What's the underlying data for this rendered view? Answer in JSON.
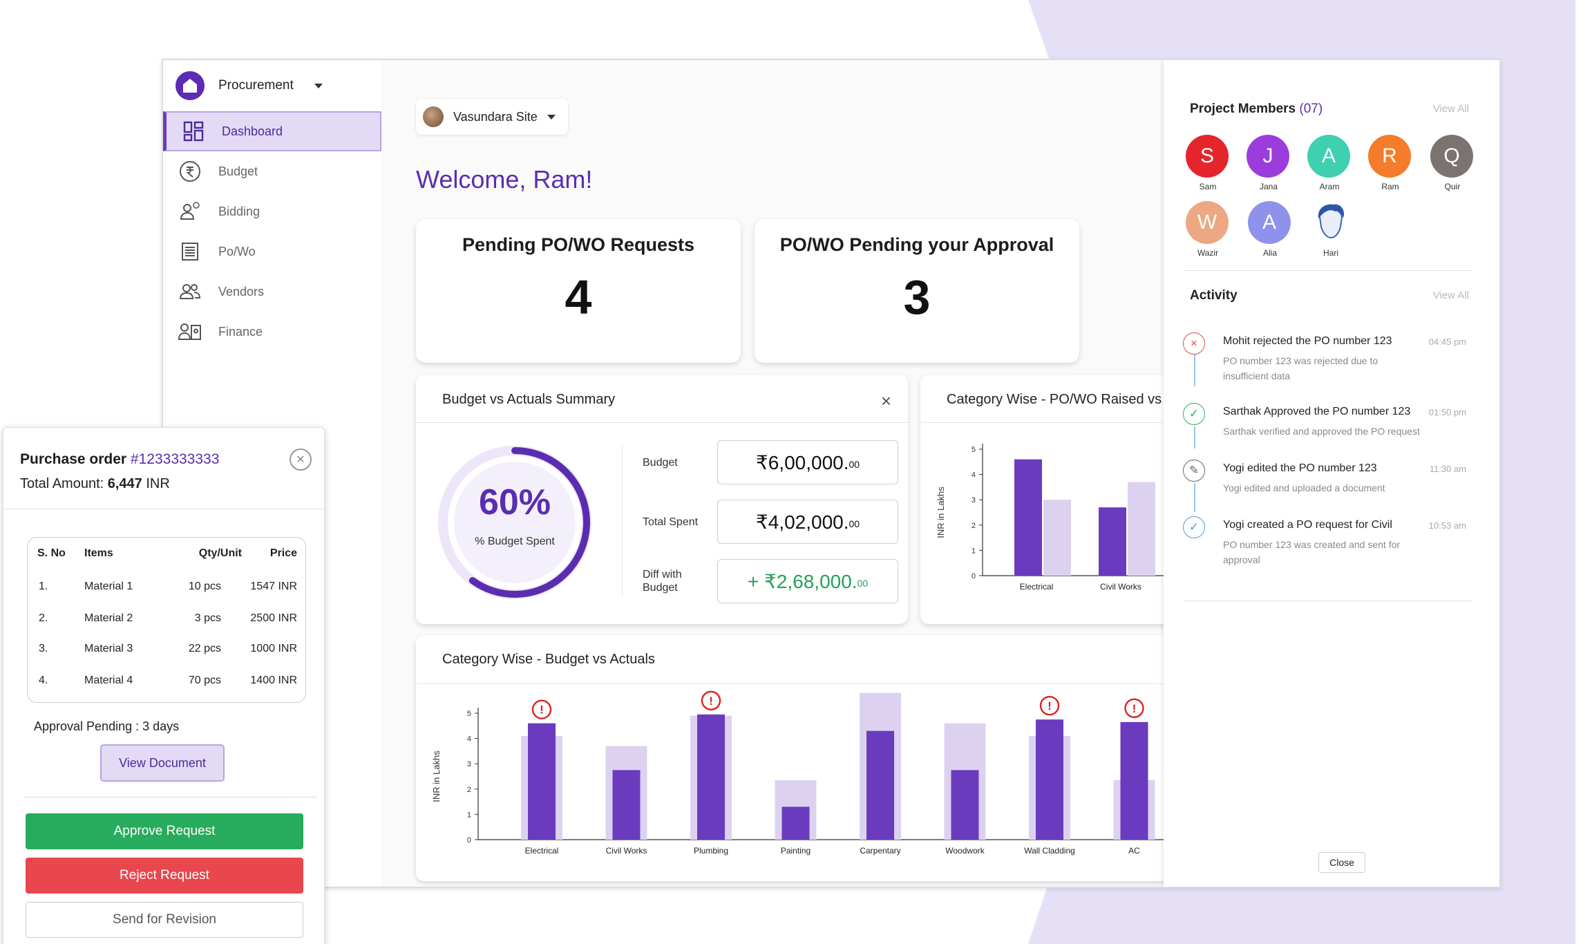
{
  "sidebar": {
    "brand": "Procurement",
    "items": [
      {
        "label": "Dashboard",
        "icon": "dashboard-grid-icon",
        "active": true
      },
      {
        "label": "Budget",
        "icon": "rupee-circle-icon"
      },
      {
        "label": "Bidding",
        "icon": "user-bid-icon"
      },
      {
        "label": "Po/Wo",
        "icon": "document-list-icon"
      },
      {
        "label": "Vendors",
        "icon": "users-icon"
      },
      {
        "label": "Finance",
        "icon": "id-card-icon"
      }
    ]
  },
  "header": {
    "site": "Vasundara Site",
    "welcome": "Welcome, Ram!"
  },
  "stats": {
    "pending_title": "Pending PO/WO Requests",
    "pending_value": "4",
    "approval_title": "PO/WO Pending your Approval",
    "approval_value": "3"
  },
  "budget_summary": {
    "title": "Budget vs Actuals Summary",
    "close": "×",
    "percent": "60%",
    "percent_label": "% Budget Spent",
    "budget_label": "Budget",
    "budget_main": "₹6,00,000.",
    "budget_decimal": "00",
    "spent_label": "Total Spent",
    "spent_main": "₹4,02,000.",
    "spent_decimal": "00",
    "diff_label": "Diff with Budget",
    "diff_main": "+ ₹2,68,000.",
    "diff_decimal": "00"
  },
  "category_raised": {
    "title": "Category Wise - PO/WO Raised vs F"
  },
  "category_budget": {
    "title": "Category Wise - Budget vs Actuals"
  },
  "chart_data": [
    {
      "type": "bar",
      "title": "Category Wise - PO/WO Raised vs F",
      "ylabel": "INR in Lakhs",
      "ylim": [
        0,
        5
      ],
      "yticks": [
        "0",
        "1",
        "2",
        "3",
        "4",
        "5"
      ],
      "categories": [
        "Electrical",
        "Civil Works"
      ],
      "series": [
        {
          "values": [
            4.6,
            2.7
          ],
          "color": "#6a3bbf"
        },
        {
          "values": [
            3.0,
            3.7
          ],
          "color": "#dcd2f0"
        }
      ]
    },
    {
      "type": "bar",
      "title": "Category Wise - Budget vs Actuals",
      "ylabel": "INR in Lakhs",
      "ylim": [
        0,
        5
      ],
      "yticks": [
        "0",
        "1",
        "2",
        "3",
        "4",
        "5"
      ],
      "categories": [
        "Electrical",
        "Civil Works",
        "Plumbing",
        "Painting",
        "Carpentary",
        "Woodwork",
        "Wall Cladding",
        "AC"
      ],
      "series": [
        {
          "values": [
            4.1,
            3.7,
            4.9,
            2.35,
            5.8,
            4.6,
            4.1,
            2.35
          ],
          "color": "#dcd2f0"
        },
        {
          "values": [
            4.6,
            2.75,
            4.95,
            1.3,
            4.3,
            2.75,
            4.75,
            4.65
          ],
          "color": "#6a3bbf"
        }
      ],
      "alerts": [
        true,
        false,
        true,
        false,
        false,
        false,
        true,
        true
      ]
    }
  ],
  "members": {
    "title": "Project Members",
    "count": "(07)",
    "view_all": "View All",
    "list": [
      {
        "initial": "S",
        "name": "Sam",
        "color": "#e4262c"
      },
      {
        "initial": "J",
        "name": "Jana",
        "color": "#9b3ddd"
      },
      {
        "initial": "A",
        "name": "Aram",
        "color": "#3fd0b0"
      },
      {
        "initial": "R",
        "name": "Ram",
        "color": "#f57c2a"
      },
      {
        "initial": "Q",
        "name": "Quir",
        "color": "#7b7370"
      },
      {
        "initial": "W",
        "name": "Wazir",
        "color": "#eba882"
      },
      {
        "initial": "A",
        "name": "Alia",
        "color": "#8f92ec"
      },
      {
        "initial": "",
        "name": "Hari",
        "color": "#6f8fc8"
      }
    ]
  },
  "activity": {
    "title": "Activity",
    "view_all": "View All",
    "items": [
      {
        "icon": "×",
        "color": "#e4484e",
        "title": "Mohit rejected the PO number 123",
        "desc": "PO number 123 was rejected due to insufficient data",
        "time": "04:45 pm"
      },
      {
        "icon": "✓",
        "color": "#2fae66",
        "title": "Sarthak Approved the PO number 123",
        "desc": "Sarthak verified and approved the PO request",
        "time": "01:50 pm"
      },
      {
        "icon": "✎",
        "color": "#666666",
        "title": "Yogi edited the PO number 123",
        "desc": "Yogi edited and uploaded a document",
        "time": "11:30 am"
      },
      {
        "icon": "✓",
        "color": "#4a9be0",
        "title": "Yogi created a PO request for Civil",
        "desc": "PO number 123 was created and sent for approval",
        "time": "10:53 am"
      }
    ],
    "close": "Close"
  },
  "purchase_order": {
    "title": "Purchase order",
    "number": "#1233333333",
    "total_label": "Total Amount:",
    "total_value": "6,447",
    "currency": "INR",
    "headers": [
      "S. No",
      "Items",
      "Qty/Unit",
      "Price"
    ],
    "rows": [
      [
        "1.",
        "Material 1",
        "10 pcs",
        "1547 INR"
      ],
      [
        "2.",
        "Material 2",
        "3 pcs",
        "2500 INR"
      ],
      [
        "3.",
        "Material 3",
        "22 pcs",
        "1000 INR"
      ],
      [
        "4.",
        "Material 4",
        "70 pcs",
        "1400 INR"
      ]
    ],
    "approval_label": "Approval Pending",
    "approval_value": ": 3 days",
    "view_document": "View Document",
    "approve": "Approve Request",
    "reject": "Reject Request",
    "revise": "Send for Revision"
  },
  "colors": {
    "accent": "#5a2db0",
    "bar_dark": "#6a3bbf",
    "bar_light": "#dcd2f0",
    "alert": "#e02020",
    "approve": "#27ab5c",
    "reject": "#e8474d"
  }
}
